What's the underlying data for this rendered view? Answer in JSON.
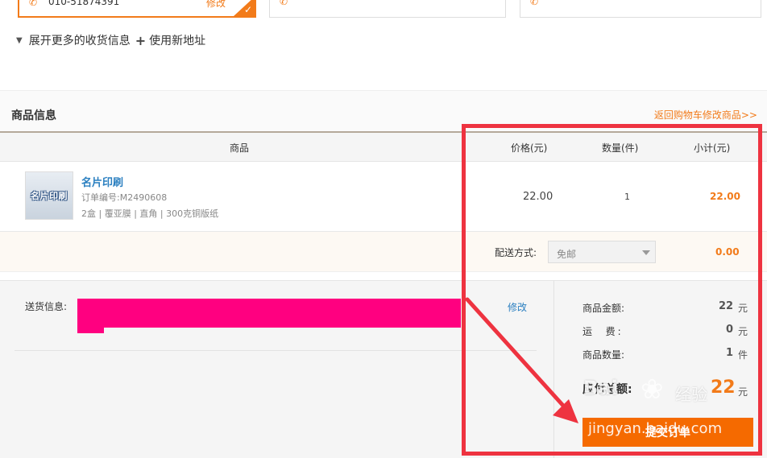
{
  "address_cards": {
    "selected": {
      "phone": "010-51874391",
      "edit_label": "修改"
    }
  },
  "address_actions": {
    "expand_label": "展开更多的收货信息",
    "new_address_label": "使用新地址"
  },
  "section": {
    "title": "商品信息",
    "back_link": "返回购物车修改商品>>"
  },
  "table": {
    "headers": {
      "product": "商品",
      "price": "价格(元)",
      "qty": "数量(件)",
      "subtotal": "小计(元)"
    },
    "rows": [
      {
        "thumb_text": "名片印刷",
        "name": "名片印刷",
        "order_no": "订单编号:M2490608",
        "specs": "2盒 | 覆亚膜 | 直角 | 300克铜版纸",
        "price": "22.00",
        "qty": "1",
        "subtotal": "22.00"
      }
    ]
  },
  "shipping": {
    "label": "配送方式:",
    "selected": "免邮",
    "fee": "0.00"
  },
  "delivery": {
    "label": "送货信息:",
    "modify_label": "修改"
  },
  "summary": {
    "amount_label": "商品金额:",
    "amount_value": "22",
    "freight_label": "运  费:",
    "freight_value": "0",
    "count_label": "商品数量:",
    "count_value": "1",
    "currency_unit": "元",
    "count_unit": "件",
    "total_label": "应付总额:",
    "total_value": "22",
    "submit_label": "提交订单"
  },
  "watermark": {
    "logo": "Bai",
    "brand": "经验",
    "url": "jingyan.baidu.com"
  },
  "colors": {
    "accent": "#f27b1a",
    "link": "#2a7fc0",
    "annotation": "#ee3340",
    "redaction": "#ff0080"
  }
}
